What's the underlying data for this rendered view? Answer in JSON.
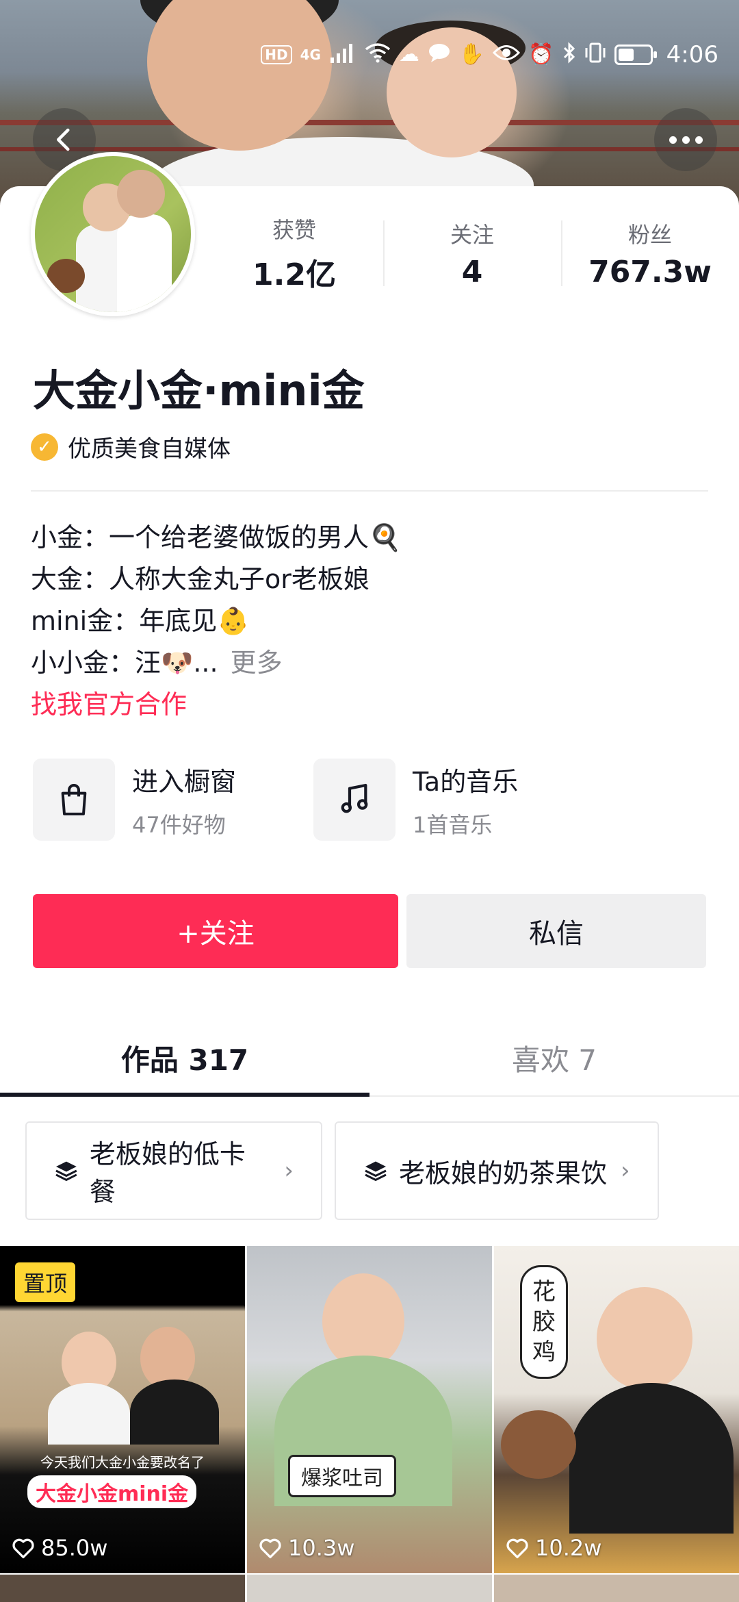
{
  "status_bar": {
    "hd": "HD",
    "network": "4G",
    "time": "4:06"
  },
  "profile": {
    "name": "大金小金·mini金",
    "verification": "优质美食自媒体",
    "stats": [
      {
        "label": "获赞",
        "value": "1.2亿"
      },
      {
        "label": "关注",
        "value": "4"
      },
      {
        "label": "粉丝",
        "value": "767.3w"
      }
    ],
    "bio": {
      "line1": "小金：一个给老婆做饭的男人🍳",
      "line2": "大金：人称大金丸子or老板娘",
      "line3": "mini金：年底见👶",
      "line4": "小小金：汪🐶...",
      "more": "更多",
      "link": "找我官方合作"
    }
  },
  "shortcuts": [
    {
      "icon": "shopping-bag-icon",
      "title": "进入橱窗",
      "subtitle": "47件好物"
    },
    {
      "icon": "music-note-icon",
      "title": "Ta的音乐",
      "subtitle": "1首音乐"
    }
  ],
  "actions": {
    "follow": "+关注",
    "message": "私信"
  },
  "tabs": [
    {
      "label": "作品 317",
      "active": true
    },
    {
      "label": "喜欢 7",
      "active": false
    }
  ],
  "collections": [
    {
      "label": "老板娘的低卡餐"
    },
    {
      "label": "老板娘的奶茶果饮"
    }
  ],
  "videos": [
    {
      "pinned_label": "置顶",
      "caption_small": "今天我们大金小金要改名了",
      "caption_big": "大金小金mini金",
      "likes": "85.0w"
    },
    {
      "label": "爆浆吐司",
      "likes": "10.3w"
    },
    {
      "label": "花胶鸡",
      "likes": "10.2w"
    }
  ],
  "colors": {
    "accent": "#fe2c55",
    "text": "#161823",
    "muted": "#8a8b91",
    "pin": "#ffd633",
    "verify": "#f7b733"
  }
}
